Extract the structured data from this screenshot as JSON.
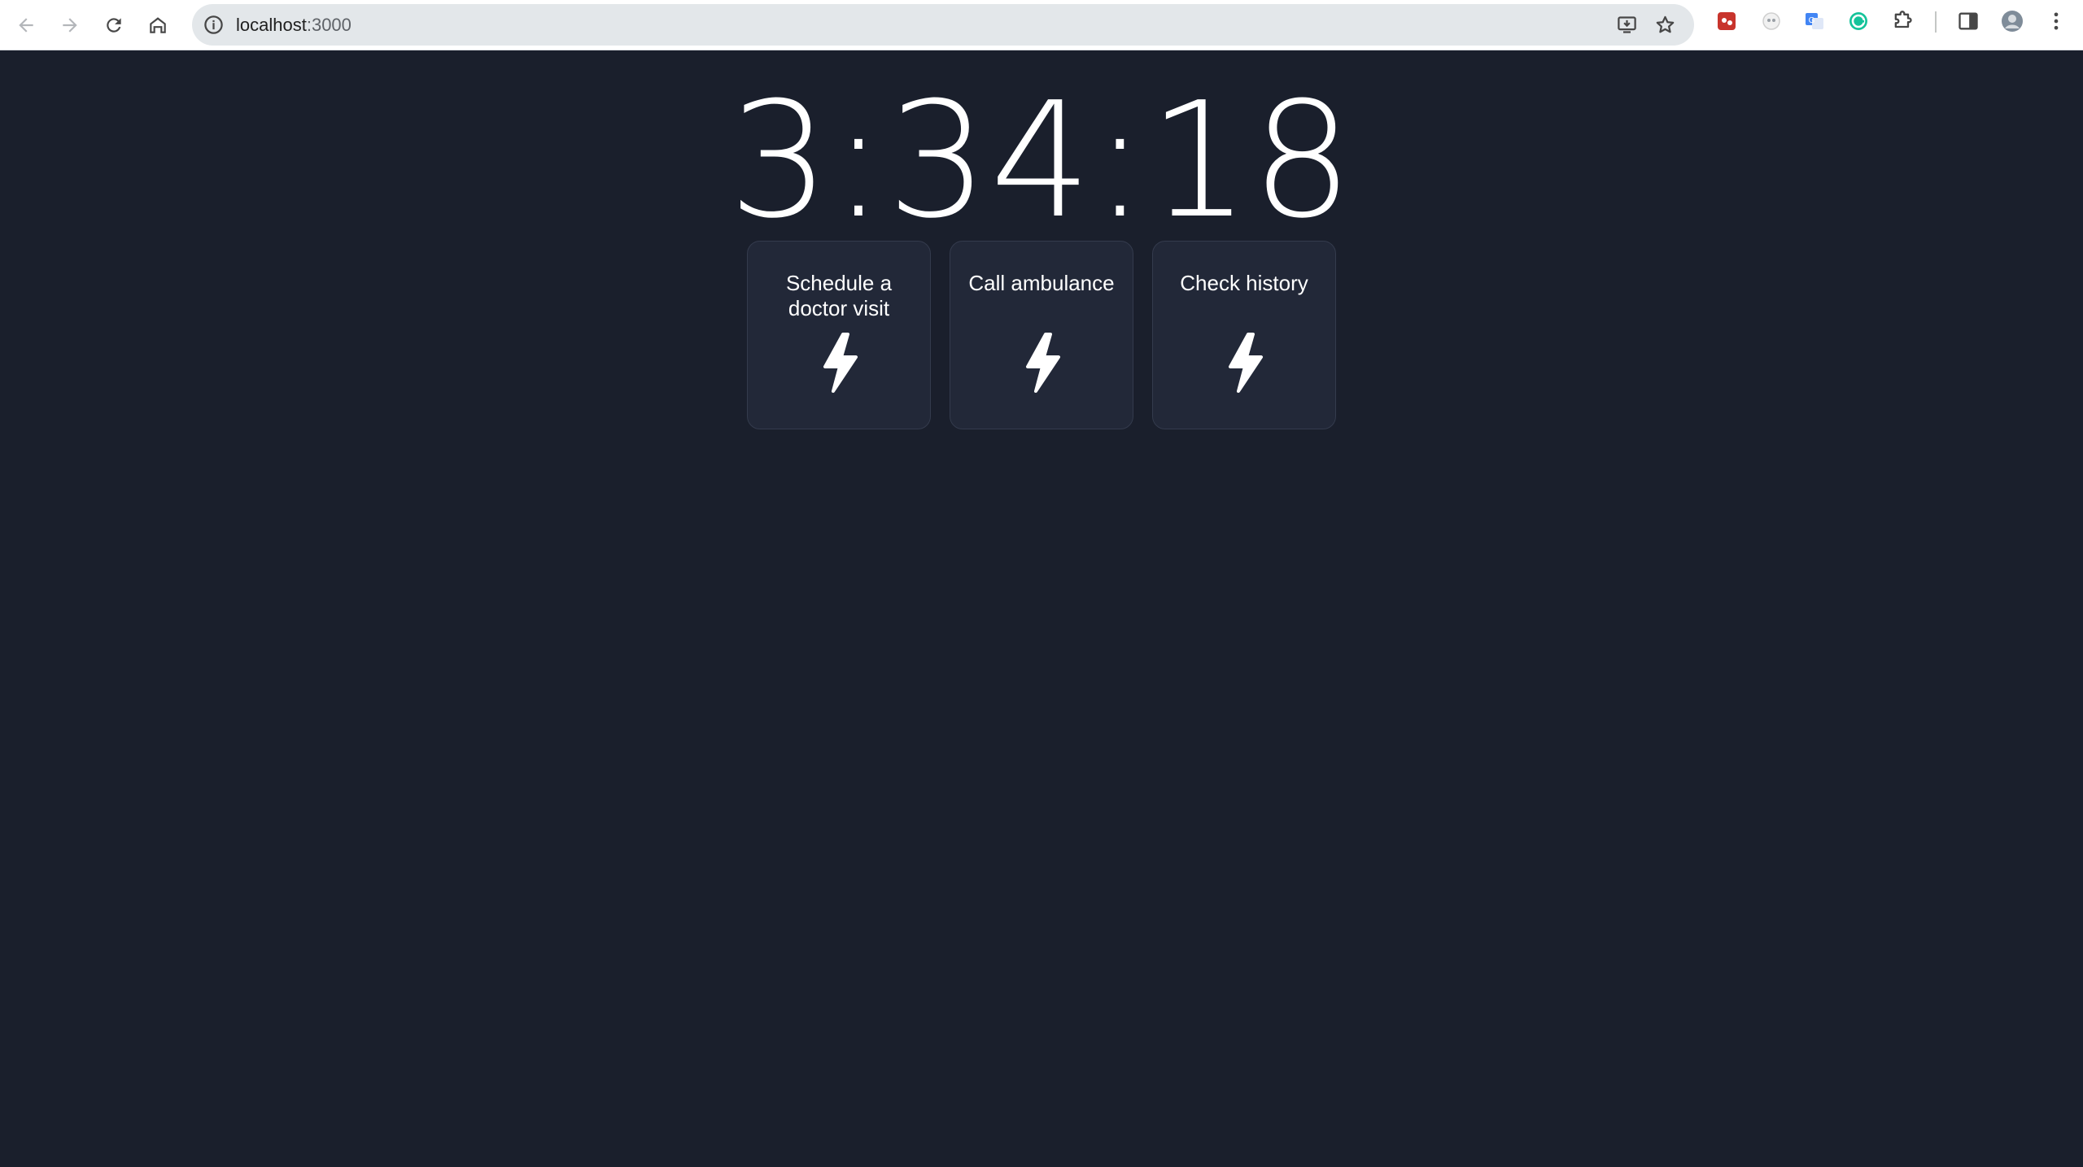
{
  "browser": {
    "url_host": "localhost",
    "url_port": ":3000"
  },
  "clock": {
    "time": "3:34:18"
  },
  "actions": [
    {
      "label": "Schedule a doctor visit",
      "icon": "lightning-icon"
    },
    {
      "label": "Call ambulance",
      "icon": "lightning-icon"
    },
    {
      "label": "Check history",
      "icon": "lightning-icon"
    }
  ],
  "colors": {
    "background": "#1a1f2c",
    "card": "#222838",
    "text": "#ffffff"
  }
}
